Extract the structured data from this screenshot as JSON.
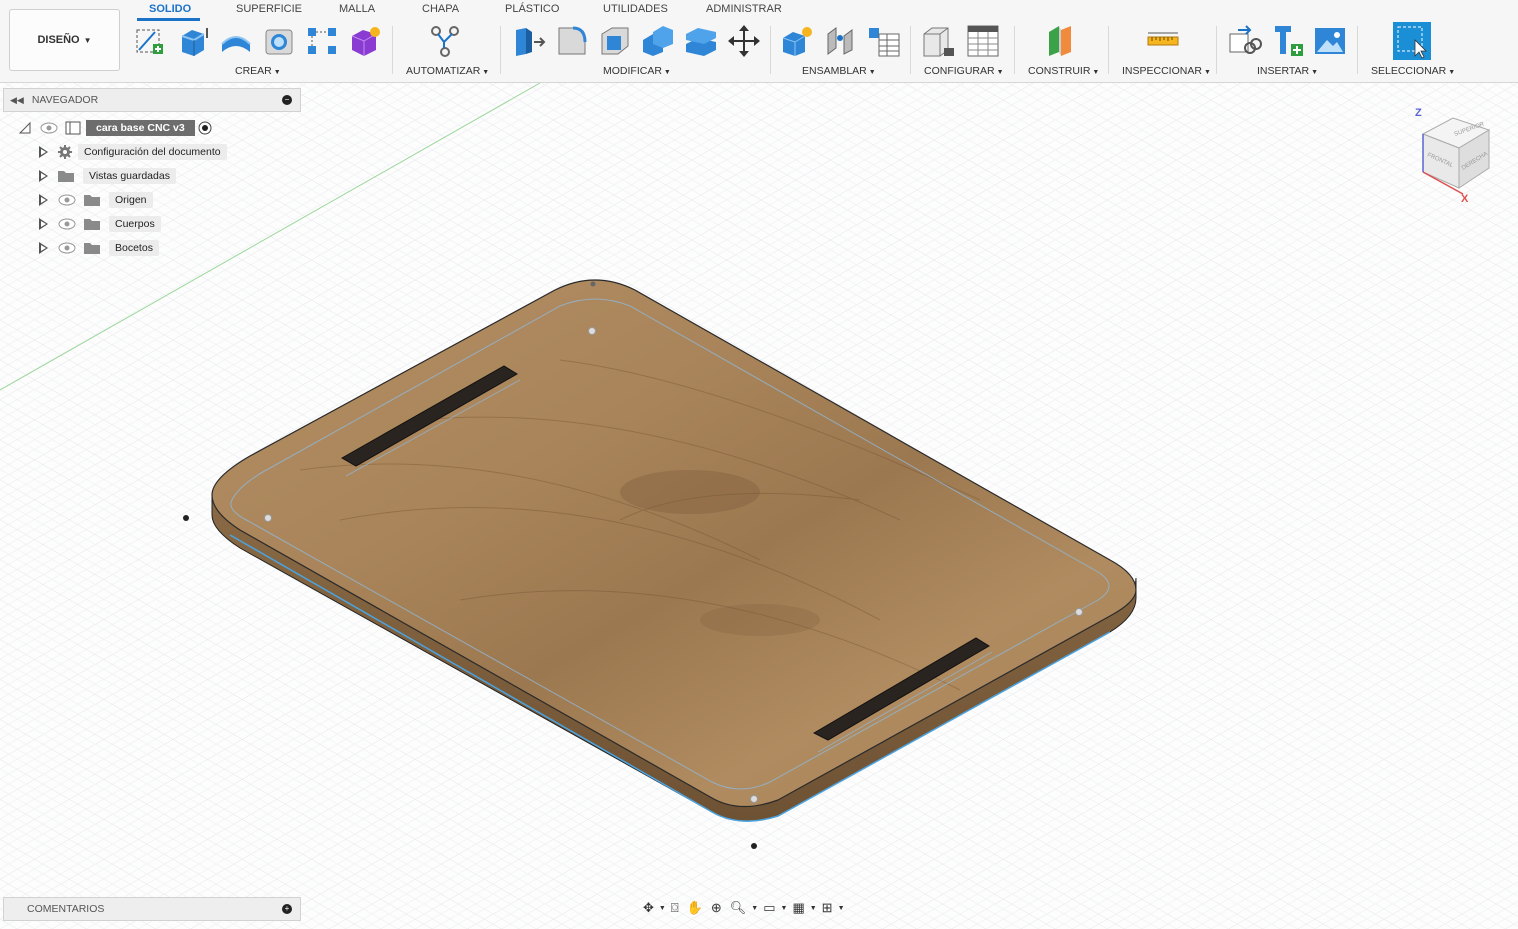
{
  "toolbar": {
    "workspace": "DISEÑO",
    "tabs": [
      "SOLIDO",
      "SUPERFICIE",
      "MALLA",
      "CHAPA",
      "PLÁSTICO",
      "UTILIDADES",
      "ADMINISTRAR"
    ],
    "active_tab": "SOLIDO",
    "groups": [
      "CREAR",
      "AUTOMATIZAR",
      "MODIFICAR",
      "ENSAMBLAR",
      "CONFIGURAR",
      "CONSTRUIR",
      "INSPECCIONAR",
      "INSERTAR",
      "SELECCIONAR"
    ]
  },
  "navigator": {
    "title": "NAVEGADOR",
    "root": "cara base CNC v3",
    "items": [
      "Configuración del documento",
      "Vistas guardadas",
      "Origen",
      "Cuerpos",
      "Bocetos"
    ]
  },
  "comments": {
    "title": "COMENTARIOS"
  },
  "viewcube": {
    "top": "SUPERIOR",
    "front": "FRONTAL",
    "right": "DERECHA",
    "axis_x": "X",
    "axis_z": "Z"
  },
  "colors": {
    "accent": "#1a73c9",
    "wood": "#a8825a"
  }
}
